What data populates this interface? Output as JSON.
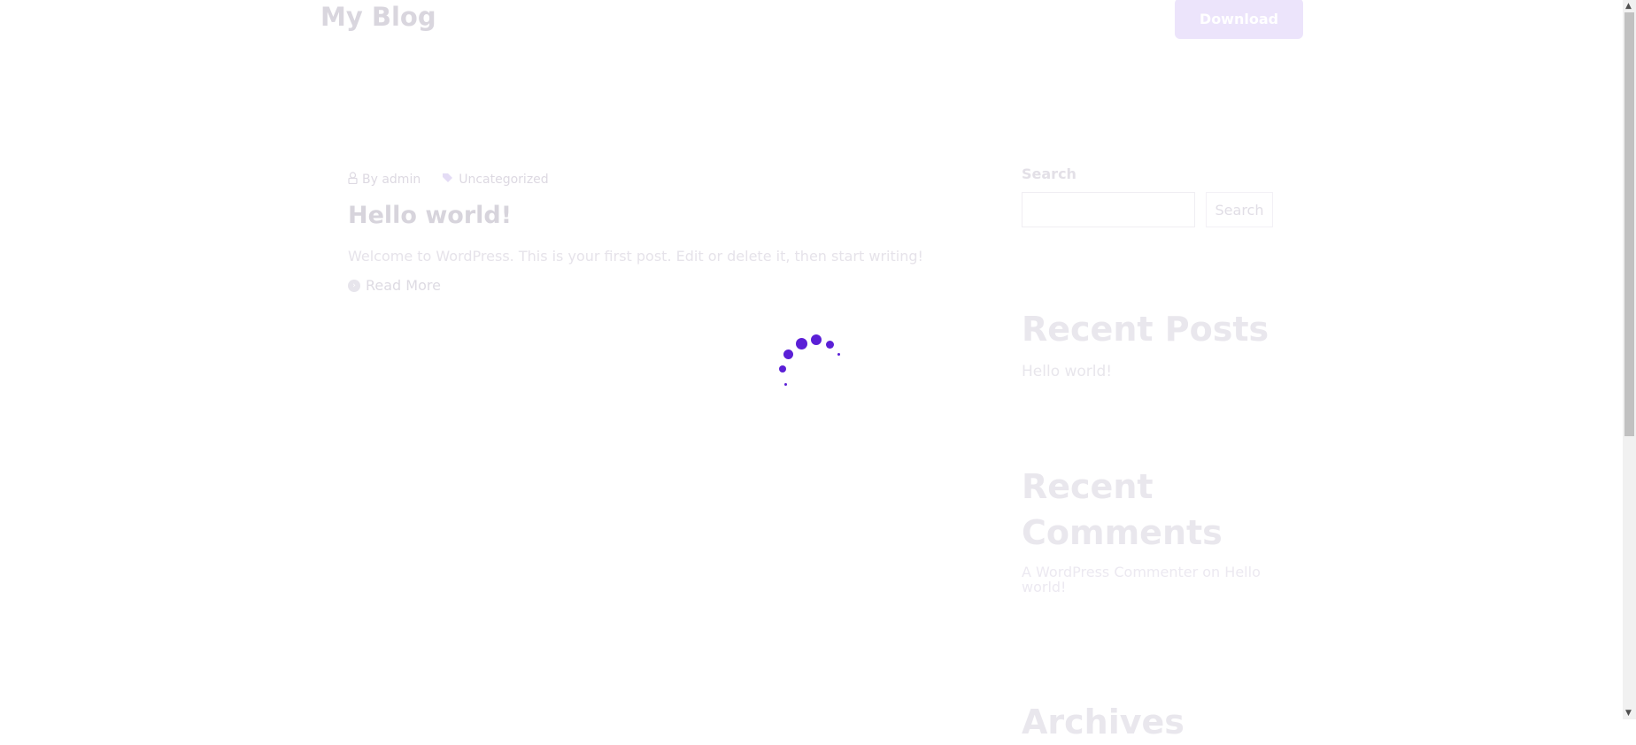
{
  "header": {
    "site_title": "My Blog",
    "download_label": "Download"
  },
  "post": {
    "author": "By admin",
    "category": "Uncategorized",
    "title": "Hello world!",
    "excerpt": "Welcome to WordPress. This is your first post. Edit or delete it, then start writing!",
    "read_more": "Read More"
  },
  "sidebar": {
    "search_label": "Search",
    "search_button": "Search",
    "search_placeholder": "",
    "recent_posts_title": "Recent Posts",
    "recent_posts": [
      "Hello world!"
    ],
    "recent_comments_title": "Recent Comments",
    "comment_author": "A WordPress Commenter",
    "comment_on": "on",
    "comment_post": "Hello world!",
    "archives_title": "Archives"
  },
  "colors": {
    "spinner": "#5b1fd6",
    "download_button_bg": "#ece4fb"
  },
  "icons": {
    "author": "user-icon",
    "category": "tag-icon",
    "read_more": "arrow-circle-icon",
    "loading": "loading-spinner-icon"
  }
}
